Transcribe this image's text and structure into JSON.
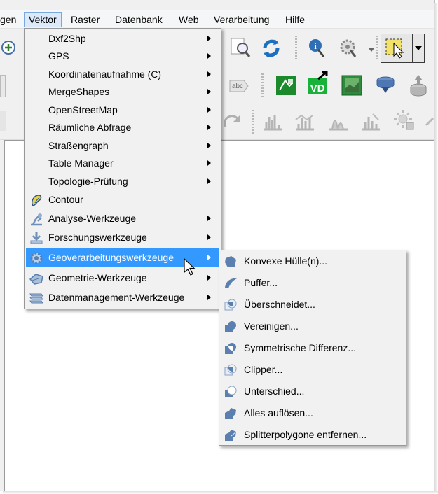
{
  "menubar": {
    "items": [
      {
        "label": "gen",
        "active": false
      },
      {
        "label": "Vektor",
        "active": true
      },
      {
        "label": "Raster",
        "active": false
      },
      {
        "label": "Datenbank",
        "active": false
      },
      {
        "label": "Web",
        "active": false
      },
      {
        "label": "Verarbeitung",
        "active": false
      },
      {
        "label": "Hilfe",
        "active": false
      }
    ]
  },
  "vector_menu": {
    "items": [
      {
        "label": "Dxf2Shp",
        "submenu": true
      },
      {
        "label": "GPS",
        "submenu": true
      },
      {
        "label": "Koordinatenaufnahme (C)",
        "submenu": true
      },
      {
        "label": "MergeShapes",
        "submenu": true
      },
      {
        "label": "OpenStreetMap",
        "submenu": true
      },
      {
        "label": "Räumliche Abfrage",
        "submenu": true
      },
      {
        "label": "Straßengraph",
        "submenu": true
      },
      {
        "label": "Table Manager",
        "submenu": true
      },
      {
        "label": "Topologie-Prüfung",
        "submenu": true
      },
      {
        "label": "Contour",
        "submenu": false,
        "icon": "contour-icon"
      },
      {
        "label": "Analyse-Werkzeuge",
        "submenu": true,
        "icon": "analysis-tools-icon"
      },
      {
        "label": "Forschungswerkzeuge",
        "submenu": true,
        "icon": "research-tools-icon"
      },
      {
        "label": "Geoverarbeitungswerkzeuge",
        "submenu": true,
        "icon": "geoprocessing-tools-icon",
        "highlighted": true
      },
      {
        "label": "Geometrie-Werkzeuge",
        "submenu": true,
        "icon": "geometry-tools-icon"
      },
      {
        "label": "Datenmanagement-Werkzeuge",
        "submenu": true,
        "icon": "data-management-tools-icon"
      }
    ]
  },
  "geoprocessing_submenu": {
    "items": [
      {
        "label": "Konvexe Hülle(n)...",
        "icon": "convex-hull-icon"
      },
      {
        "label": "Puffer...",
        "icon": "buffer-icon"
      },
      {
        "label": "Überschneidet...",
        "icon": "intersect-icon"
      },
      {
        "label": "Vereinigen...",
        "icon": "union-icon"
      },
      {
        "label": "Symmetrische Differenz...",
        "icon": "symmetric-difference-icon"
      },
      {
        "label": "Clipper...",
        "icon": "clip-icon"
      },
      {
        "label": "Unterschied...",
        "icon": "difference-icon"
      },
      {
        "label": "Alles auflösen...",
        "icon": "dissolve-icon"
      },
      {
        "label": "Splitterpolygone entfernen...",
        "icon": "eliminate-sliver-icon"
      }
    ]
  },
  "colors": {
    "highlight": "#3399ff",
    "menu_bg": "#f1f1f1",
    "menubar_active": "#dbe9f9",
    "submenu_icon": "#5b7fae"
  }
}
